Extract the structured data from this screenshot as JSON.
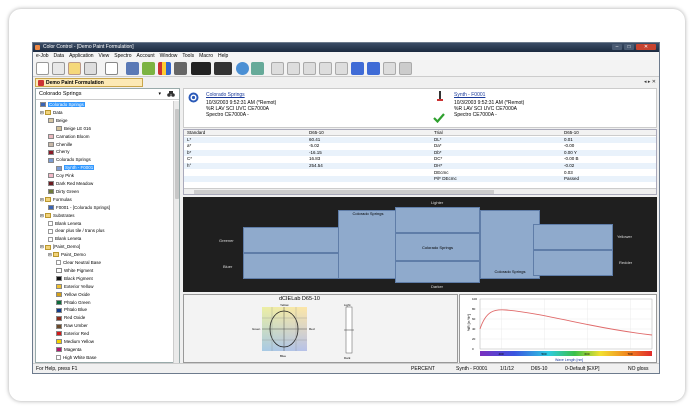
{
  "window": {
    "title": "Color Control - [Demo Paint Formulation]"
  },
  "menu": [
    "e-Job",
    "Data",
    "Application",
    "View",
    "Spectro",
    "Account",
    "Window",
    "Tools",
    "Macro",
    "Help"
  ],
  "doc_tab": "Demo Paint Formulation",
  "tab_arrows": "◂ ▸ ✕",
  "left": {
    "search_value": "Colorado Springs",
    "tree": [
      {
        "label": "Colorado Springs",
        "indent": 0,
        "kind": "item",
        "color": "#3a64b4",
        "selected": true
      },
      {
        "label": "Data",
        "indent": 0,
        "kind": "folder"
      },
      {
        "label": "Beige",
        "indent": 1,
        "kind": "item",
        "color": "#d8c7a3"
      },
      {
        "label": "Beige LE 016",
        "indent": 2,
        "kind": "item",
        "color": "#d4c29a"
      },
      {
        "label": "Carnation Bloom",
        "indent": 1,
        "kind": "item",
        "color": "#e9b7bd"
      },
      {
        "label": "Chenille",
        "indent": 1,
        "kind": "item",
        "color": "#c9b9a8"
      },
      {
        "label": "Cherry",
        "indent": 1,
        "kind": "item",
        "color": "#8a1a26"
      },
      {
        "label": "Colorado Springs",
        "indent": 1,
        "kind": "item",
        "color": "#7b9bd1"
      },
      {
        "label": "Synth - F0001",
        "indent": 2,
        "kind": "item",
        "color": "#7b9bd1",
        "selected": true
      },
      {
        "label": "Coy Pink",
        "indent": 1,
        "kind": "item",
        "color": "#f2b9c7"
      },
      {
        "label": "Dark Red Meadow",
        "indent": 1,
        "kind": "item",
        "color": "#6b1a1f"
      },
      {
        "label": "Dirty Green",
        "indent": 1,
        "kind": "item",
        "color": "#6f7a3a"
      },
      {
        "label": "Formulas",
        "indent": 0,
        "kind": "folder"
      },
      {
        "label": "F0001 - [Colorado Springs]",
        "indent": 1,
        "kind": "item",
        "color": "#3a64b4"
      },
      {
        "label": "Substrates",
        "indent": 0,
        "kind": "folder"
      },
      {
        "label": "Blank Leneta",
        "indent": 1,
        "kind": "check"
      },
      {
        "label": "clear plus tile / trans plus",
        "indent": 1,
        "kind": "check"
      },
      {
        "label": "Blank Leneta",
        "indent": 1,
        "kind": "check"
      },
      {
        "label": "[Paint_Demo]",
        "indent": 0,
        "kind": "folder"
      },
      {
        "label": "Paint_Demo",
        "indent": 1,
        "kind": "folder"
      },
      {
        "label": "Clear Neutral Base",
        "indent": 2,
        "kind": "check"
      },
      {
        "label": "White Pigment",
        "indent": 2,
        "kind": "item",
        "color": "#ffffff"
      },
      {
        "label": "Black Pigment",
        "indent": 2,
        "kind": "item",
        "color": "#111111"
      },
      {
        "label": "Exterior Yellow",
        "indent": 2,
        "kind": "item",
        "color": "#f1c232"
      },
      {
        "label": "Yellow Oxide",
        "indent": 2,
        "kind": "item",
        "color": "#d4a017"
      },
      {
        "label": "Phtalo Green",
        "indent": 2,
        "kind": "item",
        "color": "#0b6b3a"
      },
      {
        "label": "Phtalo Blue",
        "indent": 2,
        "kind": "item",
        "color": "#103a8a"
      },
      {
        "label": "Red Oxide",
        "indent": 2,
        "kind": "item",
        "color": "#8b2a1a"
      },
      {
        "label": "Raw Umber",
        "indent": 2,
        "kind": "item",
        "color": "#6b4a2a"
      },
      {
        "label": "Exterior Red",
        "indent": 2,
        "kind": "item",
        "color": "#d11a1a"
      },
      {
        "label": "Medium Yellow",
        "indent": 2,
        "kind": "item",
        "color": "#f5d000"
      },
      {
        "label": "Magenta",
        "indent": 2,
        "kind": "item",
        "color": "#b0166e"
      },
      {
        "label": "High White Base",
        "indent": 2,
        "kind": "check"
      }
    ]
  },
  "standard": {
    "name": "Colorado Springs",
    "date": "10/3/2003 9:52:31 AM (*Remot)",
    "mode": "%R LAV SCI UVC CE7000A",
    "instrument": "Spectro CE7000A -"
  },
  "trial": {
    "name": "Synth - F0001",
    "date": "10/3/2003 9:52:31 AM (*Remot)",
    "mode": "%R LAV SCI UVC CE7000A",
    "instrument": "Spectro CE7000A -"
  },
  "table": {
    "headers": [
      "Standard",
      "D65-10",
      "Trial",
      "D65-10"
    ],
    "rows": [
      [
        "L*",
        "60.41",
        "DL*",
        "0.01"
      ],
      [
        "a*",
        "-5.02",
        "Da*",
        "-0.00"
      ],
      [
        "b*",
        "-16.15",
        "Db*",
        "0.00 Y"
      ],
      [
        "C*",
        "16.83",
        "DC*",
        "-0.00 B"
      ],
      [
        "h°",
        "254.54",
        "DH*",
        "-0.02"
      ],
      [
        "",
        "",
        "DEcmc",
        "0.03"
      ],
      [
        "",
        "",
        "P/F DEcmc",
        "Passed"
      ]
    ]
  },
  "compare": {
    "lighter": "Lighter",
    "darker": "Darker",
    "greener": "Greener",
    "redder": "Redder",
    "bluer": "Bluer",
    "yellower": "Yellower",
    "block_label": "Colorado Springs"
  },
  "cielab": {
    "title": "dCIELab D65-10",
    "top": "Yellow",
    "bottom": "Blue",
    "left": "Green",
    "right": "Red",
    "lightness_top": "Light",
    "lightness_bottom": "Dark"
  },
  "spectral": {
    "ylabel": "%R [in %*]",
    "xlabel": "Wave Length [nm]",
    "x_ticks": [
      "400",
      "500",
      "600",
      "700"
    ],
    "y_ticks": [
      "100",
      "80",
      "60",
      "40",
      "20",
      "0"
    ]
  },
  "status": {
    "help": "For Help, press F1",
    "mode": "PERCENT",
    "sample": "Synth - F0001",
    "pages": "1/1/12",
    "illuminant": "D65-10",
    "default": "0-Default [EXP]",
    "gloss": "NO gloss"
  },
  "colors": {
    "accent": "#3a64b4",
    "patch": "#8faacc",
    "titlebar": "#1c2a40"
  }
}
